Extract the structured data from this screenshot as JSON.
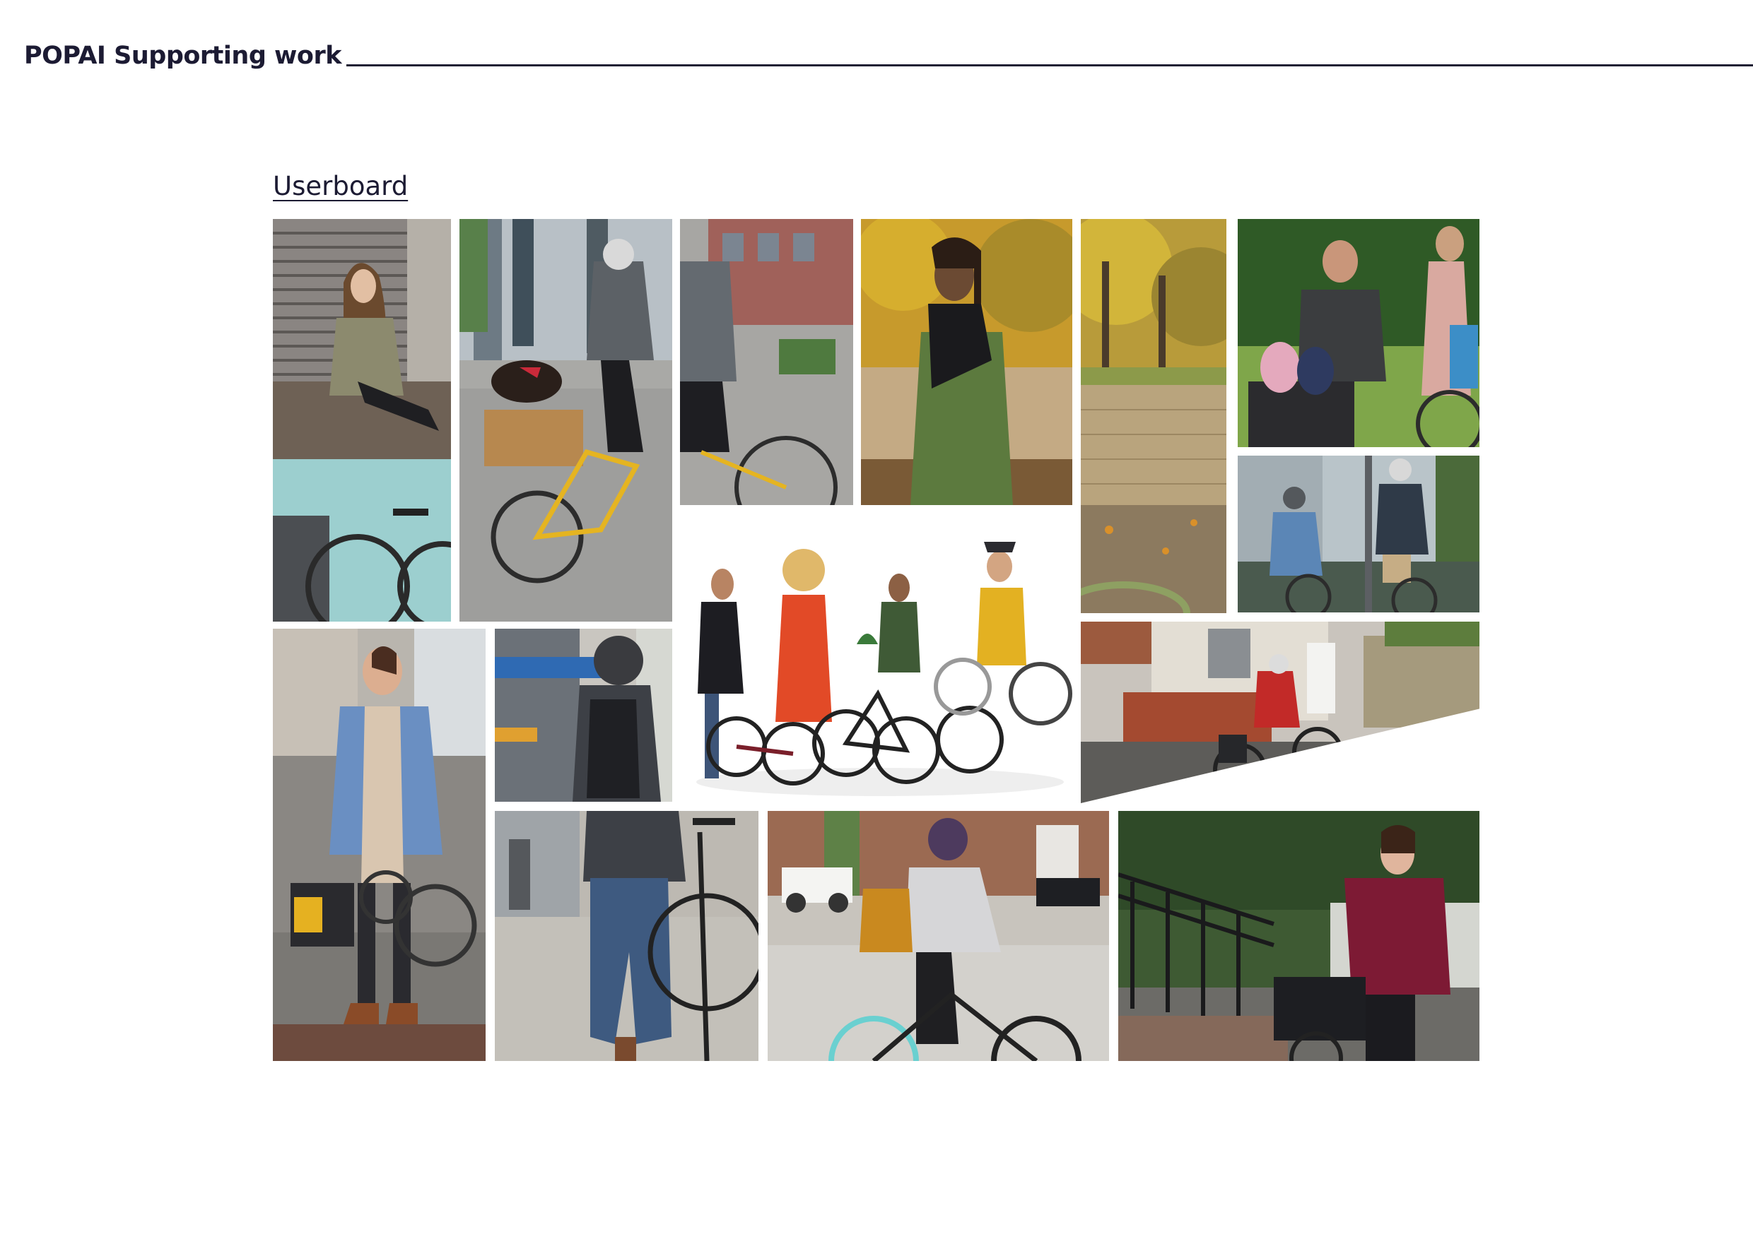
{
  "header": {
    "title": "POPAI Supporting work"
  },
  "section": {
    "title": "Userboard"
  },
  "photos": [
    {
      "id": "woman-sitting-ledge",
      "alt": "woman-sitting-ledge"
    },
    {
      "id": "cargo-bike-dog",
      "alt": "cargo-bike-dog"
    },
    {
      "id": "man-green-coat",
      "alt": "man-green-coat"
    },
    {
      "id": "autumn-park-wall",
      "alt": "autumn-park-wall"
    },
    {
      "id": "family-cargo-bike",
      "alt": "family-cargo-bike"
    },
    {
      "id": "couple-helmets-street",
      "alt": "couple-helmets-street"
    },
    {
      "id": "group-studio-bikes",
      "alt": "group-studio-bikes"
    },
    {
      "id": "rider-terrace-street",
      "alt": "rider-terrace-street"
    },
    {
      "id": "woman-folding-bike",
      "alt": "woman-folding-bike"
    },
    {
      "id": "backpack-rider-station",
      "alt": "backpack-rider-station"
    },
    {
      "id": "woman-riding-city",
      "alt": "woman-riding-city"
    },
    {
      "id": "woman-red-top-bike",
      "alt": "woman-red-top-bike"
    }
  ]
}
